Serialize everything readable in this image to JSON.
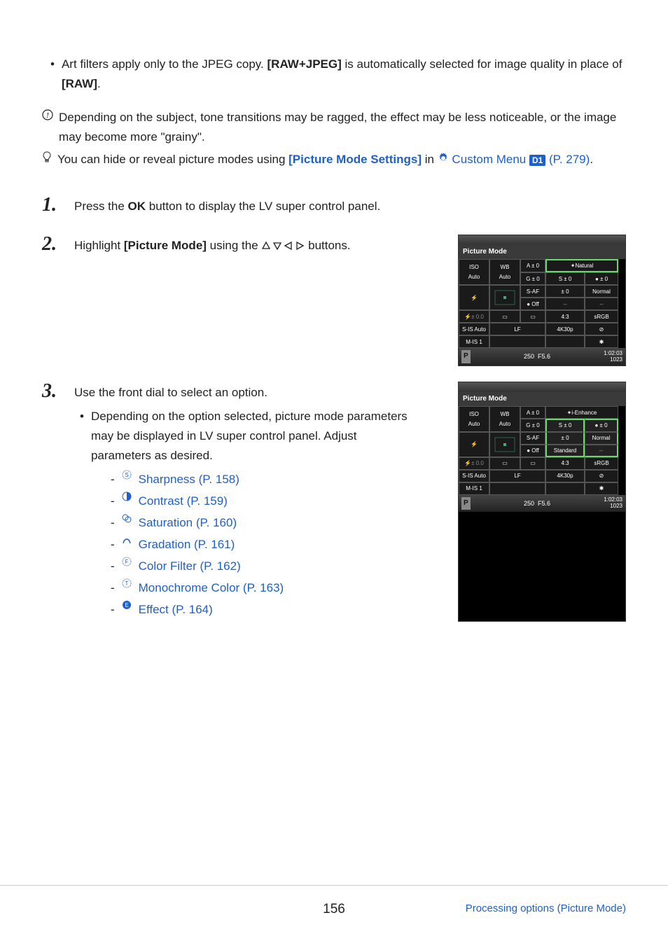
{
  "intro_bullet": {
    "pre": "Art filters apply only to the JPEG copy. ",
    "b1": "[RAW+JPEG]",
    "mid": " is automatically selected for image quality in place of ",
    "b2": "[RAW]",
    "post": "."
  },
  "note1": "Depending on the subject, tone transitions may be ragged, the effect may be less noticeable, or the image may become more \"grainy\".",
  "note2": {
    "pre": "You can hide or reveal picture modes using ",
    "link1": "[Picture Mode Settings]",
    "mid": " in ",
    "link2a": " Custom Menu ",
    "badge": "D1",
    "page": " (P. 279)",
    "post": "."
  },
  "step1": {
    "num": "1.",
    "pre": "Press the ",
    "b": "OK",
    "post": " button to display the LV super control panel."
  },
  "step2": {
    "num": "2.",
    "pre": "Highlight ",
    "b": "[Picture Mode]",
    "post": " using the ",
    "post2": " buttons."
  },
  "step3": {
    "num": "3.",
    "line": "Use the front dial to select an option.",
    "sub_bullet": "Depending on the option selected, picture mode parameters may be displayed in LV super control panel. Adjust parameters as desired.",
    "links": [
      {
        "icon": "S",
        "label": "Sharpness (P. 158)"
      },
      {
        "icon": "C",
        "label": "Contrast (P. 159)"
      },
      {
        "icon": "SAT",
        "label": "Saturation (P. 160)"
      },
      {
        "icon": "GRAD",
        "label": "Gradation (P. 161)"
      },
      {
        "icon": "CF",
        "label": "Color Filter (P. 162)"
      },
      {
        "icon": "T",
        "label": "Monochrome Color (P. 163)"
      },
      {
        "icon": "E",
        "label": "Effect (P. 164)"
      }
    ]
  },
  "lcd1": {
    "title": "Picture Mode",
    "highlight": "Natural",
    "footer_left": "P",
    "footer_shutter": "250",
    "footer_ap": "F5.6",
    "footer_time": "1:02:03",
    "footer_count": "1023",
    "cells": {
      "iso": "ISO",
      "auto": "Auto",
      "wb": "WB",
      "a0": "A ± 0",
      "g0": "G ± 0",
      "s0": "S ± 0",
      "c0": "● ± 0",
      "saf": "S-AF",
      "off": "● Off",
      "sat0": "± 0",
      "norm": "Normal",
      "fl0": "⚡± 0.0",
      "sq": "▭",
      "ai": "▭",
      "r43": "4:3",
      "srgb": "sRGB",
      "sis": "S-IS Auto",
      "mis": "M-IS 1",
      "lf": "LF",
      "k4": "4K",
      "p30": "30p",
      "diag": "⊘",
      "gear": "✱"
    }
  },
  "lcd2": {
    "title": "Picture Mode",
    "highlight": "i-Enhance",
    "footer_left": "P",
    "footer_shutter": "250",
    "footer_ap": "F5.6",
    "footer_time": "1:02:03",
    "footer_count": "1023",
    "cells": {
      "iso": "ISO",
      "auto": "Auto",
      "wb": "WB",
      "a0": "A ± 0",
      "g0": "G ± 0",
      "s0": "S ± 0",
      "c0": "● ± 0",
      "saf": "S-AF",
      "off": "● Off",
      "sat0": "± 0",
      "norm": "Normal",
      "std": "Standard",
      "fl0": "⚡± 0.0",
      "sq": "▭",
      "ai": "▭",
      "r43": "4:3",
      "srgb": "sRGB",
      "sis": "S-IS Auto",
      "mis": "M-IS 1",
      "lf": "LF",
      "k4": "4K",
      "p30": "30p",
      "diag": "⊘",
      "gear": "✱"
    }
  },
  "footer": {
    "page": "156",
    "link": "Processing options (Picture Mode)"
  }
}
